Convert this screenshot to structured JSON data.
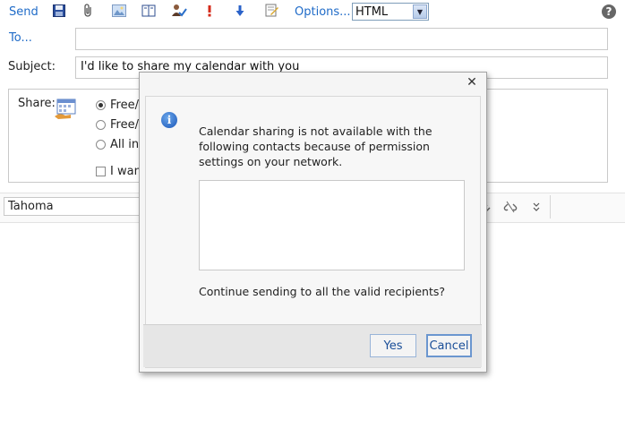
{
  "toolbar": {
    "send_label": "Send",
    "options_label": "Options...",
    "format_value": "HTML",
    "help_glyph": "?"
  },
  "to": {
    "label": "To...",
    "value": ""
  },
  "subject": {
    "label": "Subject:",
    "value": "I'd like to share my calendar with you"
  },
  "share": {
    "label": "Share:",
    "options": [
      "Free/",
      "Free/",
      "All inf"
    ],
    "checkbox_label": "I want"
  },
  "format_bar": {
    "font_name": "Tahoma"
  },
  "dialog": {
    "close_glyph": "✕",
    "info_glyph": "i",
    "message": "Calendar sharing is not available with the following contacts because of permission settings on your network.",
    "question": "Continue sending to all the valid recipients?",
    "yes_label": "Yes",
    "cancel_label": "Cancel"
  }
}
